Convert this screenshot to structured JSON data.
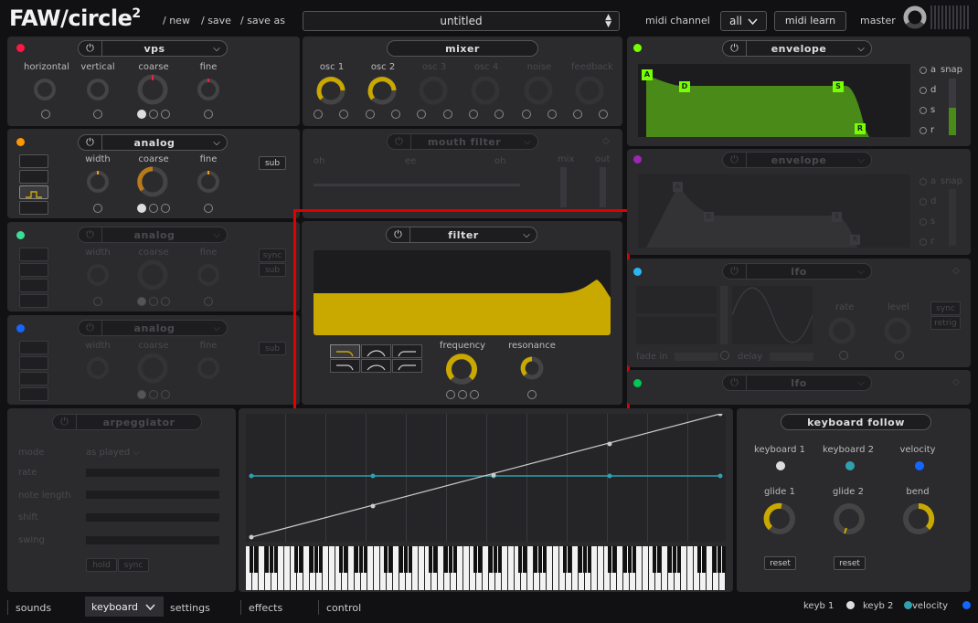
{
  "header": {
    "logo": "FAW/circle",
    "logo_sup": "2",
    "new": "/ new",
    "save": "/ save",
    "save_as": "/ save as",
    "preset": "untitled",
    "midi_channel_label": "midi channel",
    "midi_channel_value": "all",
    "midi_learn": "midi learn",
    "master": "master"
  },
  "osc1": {
    "title": "vps",
    "knobs": [
      "horizontal",
      "vertical",
      "coarse",
      "fine"
    ]
  },
  "osc2": {
    "title": "analog",
    "knobs": [
      "width",
      "coarse",
      "fine"
    ],
    "sub": "sub"
  },
  "osc3": {
    "title": "analog",
    "knobs": [
      "width",
      "coarse",
      "fine"
    ],
    "sync": "sync",
    "sub": "sub"
  },
  "osc4": {
    "title": "analog",
    "knobs": [
      "width",
      "coarse",
      "fine"
    ],
    "sub": "sub"
  },
  "mixer": {
    "title": "mixer",
    "channels": [
      "osc 1",
      "osc 2",
      "osc 3",
      "osc 4",
      "noise",
      "feedback"
    ]
  },
  "mouth_filter": {
    "title": "mouth filter",
    "vowels": [
      "oh",
      "ee",
      "oh"
    ],
    "mix": "mix",
    "out": "out"
  },
  "filter": {
    "title": "filter",
    "frequency": "frequency",
    "resonance": "resonance"
  },
  "env1": {
    "title": "envelope",
    "points": [
      "A",
      "D",
      "S",
      "R"
    ],
    "snap": "snap",
    "radios": [
      "a",
      "d",
      "s",
      "r"
    ]
  },
  "env2": {
    "title": "envelope",
    "points": [
      "A",
      "D",
      "S",
      "R"
    ],
    "snap": "snap",
    "radios": [
      "a",
      "d",
      "s",
      "r"
    ]
  },
  "lfo1": {
    "title": "lfo",
    "rate": "rate",
    "level": "level",
    "sync": "sync",
    "retrig": "retrig",
    "fade_in": "fade in",
    "delay": "delay"
  },
  "lfo2": {
    "title": "lfo"
  },
  "arp": {
    "title": "arpeggiator",
    "rows": [
      "mode",
      "rate",
      "note length",
      "shift",
      "swing"
    ],
    "mode_value": "as played",
    "hold": "hold",
    "sync": "sync"
  },
  "kbfollow": {
    "title": "keyboard follow",
    "cols": [
      "keyboard 1",
      "keyboard 2",
      "velocity"
    ],
    "knobs": [
      "glide 1",
      "glide 2",
      "bend"
    ],
    "reset": "reset"
  },
  "tabs": [
    "sounds",
    "keyboard",
    "settings",
    "effects",
    "control"
  ],
  "legend": {
    "keyb1": "keyb 1",
    "keyb2": "keyb 2",
    "velocity": "velocity"
  },
  "colors": {
    "accent": "#c9a800",
    "env_green": "#4a8a18",
    "lfo_teal": "#2fa0b0",
    "red": "#ff1744",
    "orange": "#ff9800",
    "mint": "#3ddc97",
    "blue": "#1565ff",
    "purple": "#9c27b0",
    "green": "#76ff03"
  }
}
